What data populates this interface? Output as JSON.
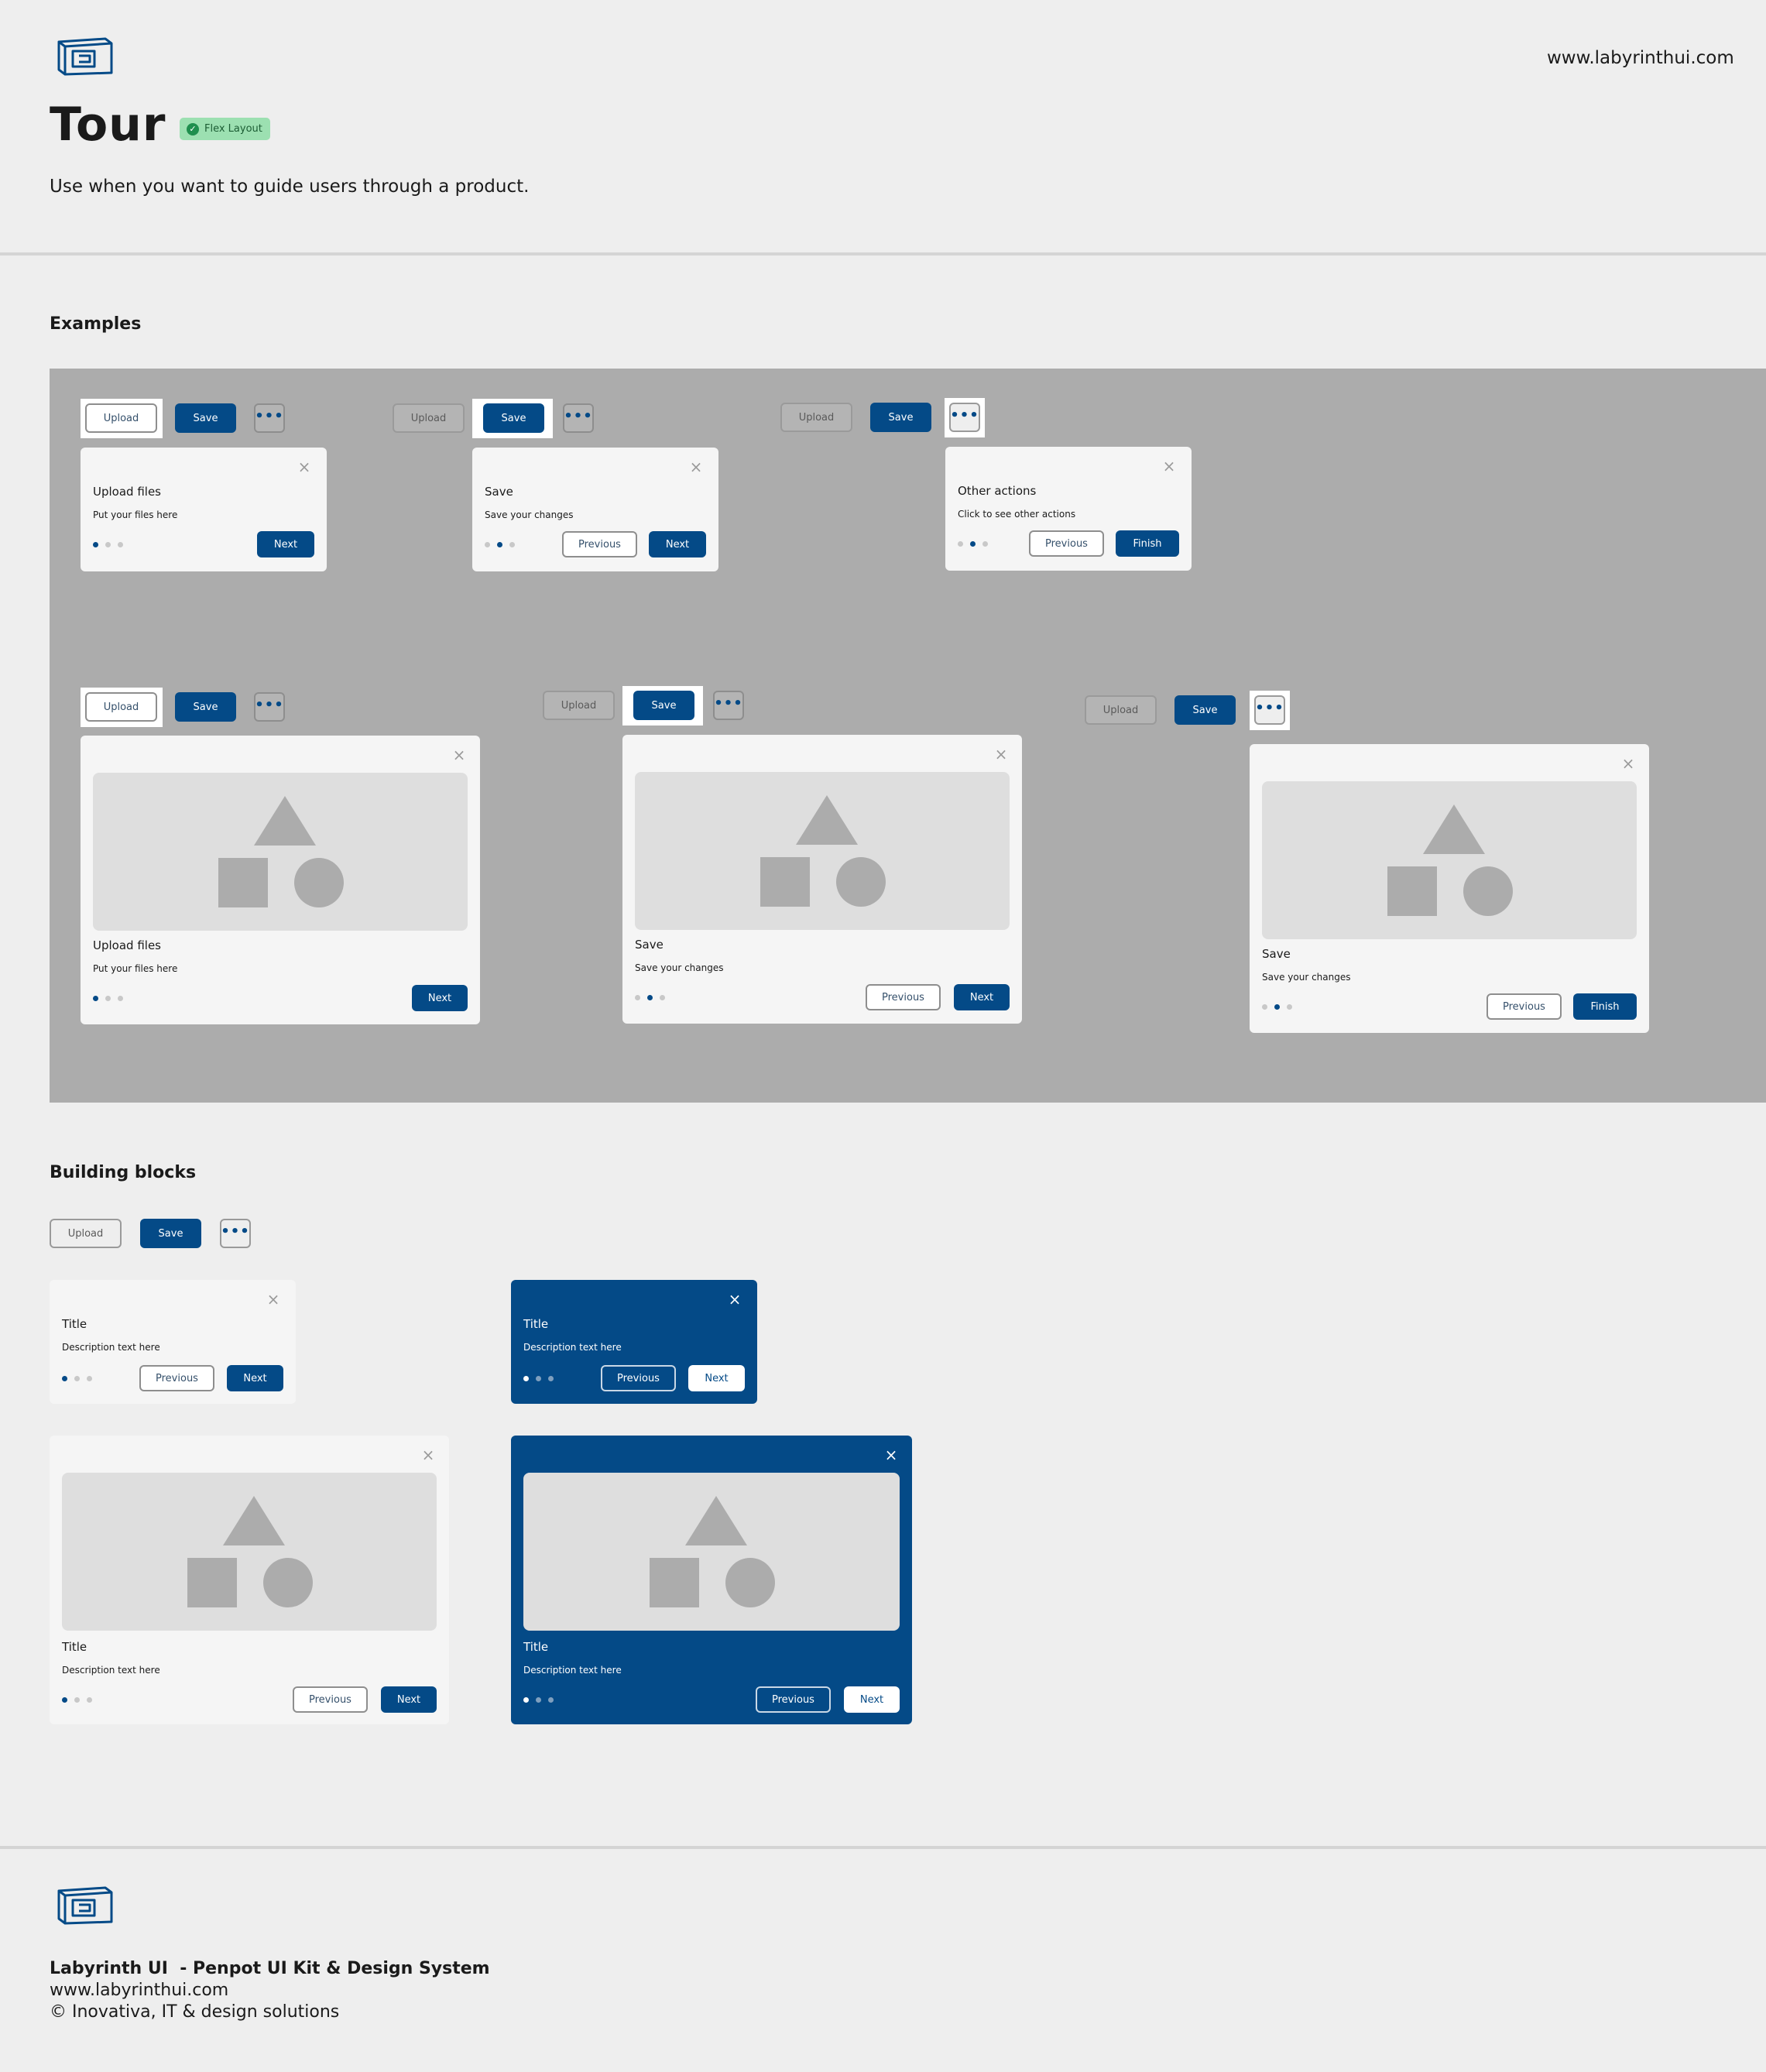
{
  "header": {
    "site_url": "www.labyrinthui.com",
    "title": "Tour",
    "badge": "Flex Layout",
    "subtitle": "Use when you want to guide users through a product."
  },
  "sections": {
    "examples": "Examples",
    "building_blocks": "Building blocks"
  },
  "buttons": {
    "upload": "Upload",
    "save": "Save",
    "more": "•••",
    "next": "Next",
    "previous": "Previous",
    "finish": "Finish",
    "close": "×"
  },
  "steps": {
    "upload": {
      "title": "Upload files",
      "desc": "Put your files here"
    },
    "save": {
      "title": "Save",
      "desc": "Save your changes"
    },
    "other": {
      "title": "Other actions",
      "desc": "Click to see other actions"
    },
    "generic": {
      "title": "Title",
      "desc": "Description text here"
    }
  },
  "footer": {
    "line1": "Labyrinth UI  - Penpot UI Kit & Design System",
    "line2": "www.labyrinthui.com",
    "line3": "© Inovativa, IT & design solutions"
  },
  "colors": {
    "primary": "#044a87",
    "page_bg": "#eeeeee",
    "examples_bg": "#acacac",
    "card_bg": "#f5f5f5",
    "badge_bg": "#9ce0b1"
  }
}
